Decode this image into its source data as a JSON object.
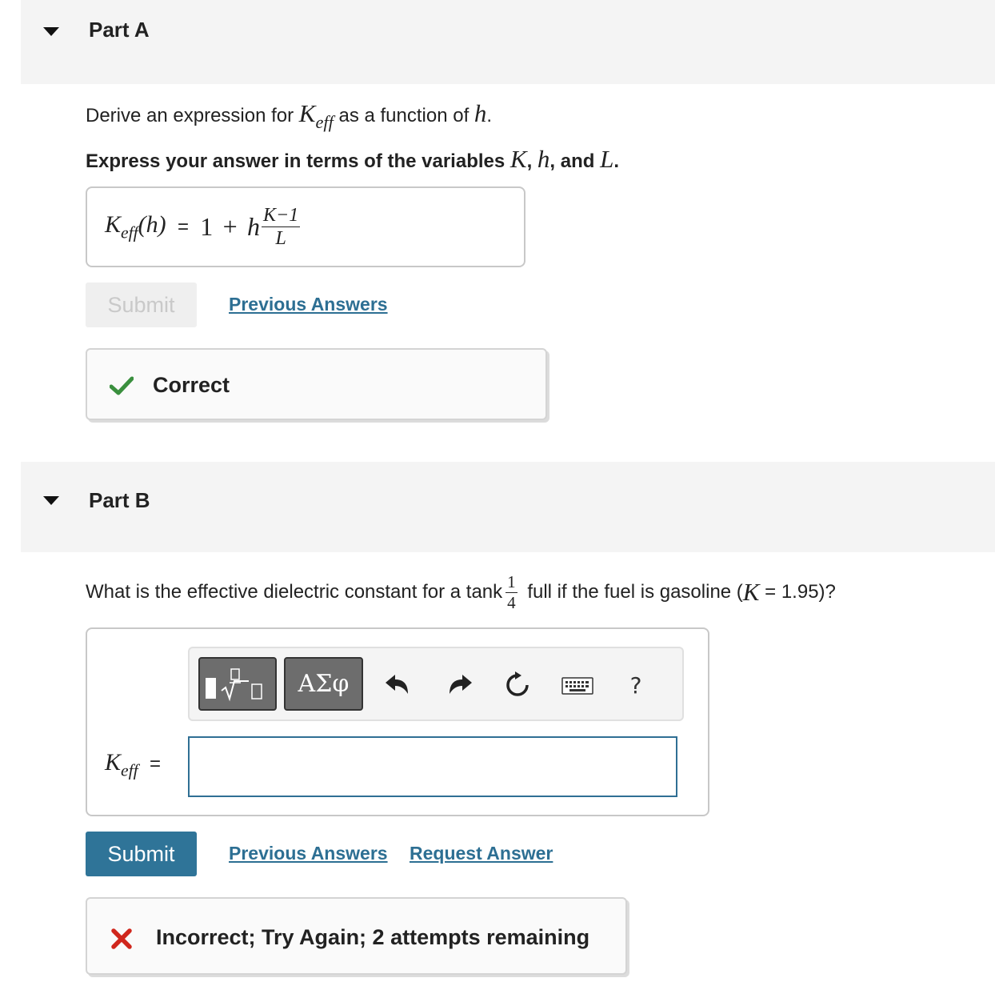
{
  "partA": {
    "title": "Part A",
    "prompt_pre": "Derive an expression for ",
    "prompt_var": "K",
    "prompt_sub": "eff",
    "prompt_mid": " as a function of ",
    "prompt_h": "h",
    "prompt_end": ".",
    "instruction_pre": "Express your answer in terms of the variables ",
    "instruction_K": "K",
    "instruction_sep1": ", ",
    "instruction_h": "h",
    "instruction_sep2": ", and ",
    "instruction_L": "L",
    "instruction_end": ".",
    "answer": {
      "lhs_var": "K",
      "lhs_sub": "eff",
      "lhs_arg": "(h)",
      "equals": "=",
      "rhs_one": "1",
      "rhs_plus": "+",
      "rhs_h": "h",
      "frac_num": "K−1",
      "frac_den": "L"
    },
    "submit_label": "Submit",
    "previous_answers_label": "Previous Answers",
    "feedback_text": "Correct",
    "feedback_status_color": "#3a8f3e"
  },
  "partB": {
    "title": "Part B",
    "prompt_pre": "What is the effective dielectric constant for a tank ",
    "frac_num": "1",
    "frac_den": "4",
    "prompt_mid": " full if the fuel is gasoline (",
    "prompt_K": "K",
    "prompt_value": " = 1.95)?",
    "toolbar": {
      "templates_icon": "fraction-sqrt-templates-icon",
      "greek_label": "ΑΣφ",
      "undo_icon": "undo-icon",
      "redo_icon": "redo-icon",
      "reset_icon": "reset-icon",
      "keyboard_icon": "keyboard-icon",
      "help_label": "?"
    },
    "input_label_var": "K",
    "input_label_sub": "eff",
    "input_label_eq": "=",
    "input_value": "",
    "submit_label": "Submit",
    "previous_answers_label": "Previous Answers",
    "request_answer_label": "Request Answer",
    "feedback_text": "Incorrect; Try Again; 2 attempts remaining",
    "feedback_status_color": "#d0271d"
  },
  "colors": {
    "accent": "#2f7498",
    "link": "#2d6f93",
    "header_bg": "#f4f4f4"
  }
}
